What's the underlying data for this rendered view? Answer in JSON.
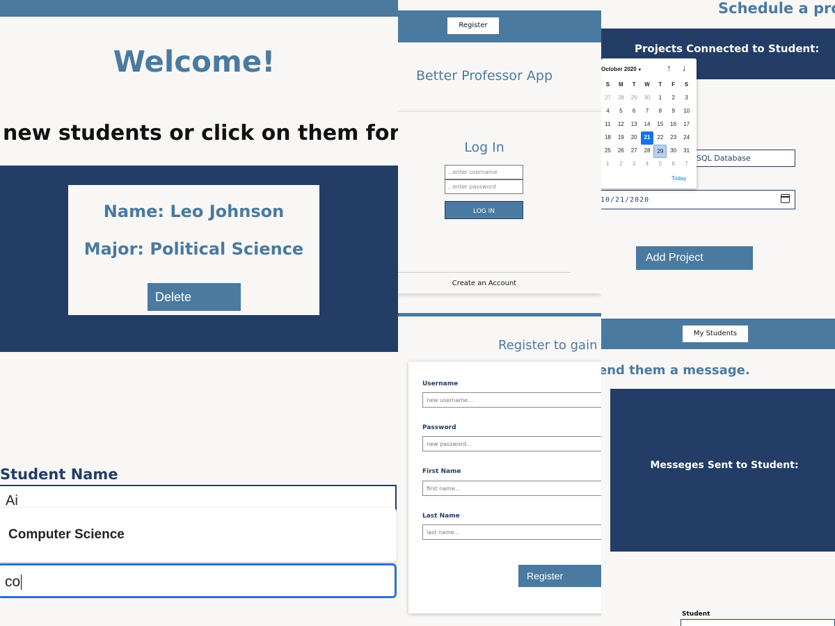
{
  "student_list_panel": {
    "welcome": "Welcome!",
    "instructions": "new students or click on them for deta",
    "student_card": {
      "name": "Name: Leo Johnson",
      "major": "Major: Political Science",
      "delete_label": "Delete"
    },
    "student_name_label": "Student Name",
    "student_name_value": "Ai",
    "suggestion": "Computer Science",
    "major_value": "co"
  },
  "login_panel": {
    "register_nav_label": "Register",
    "app_title": "Better Professor App",
    "login_title": "Log In",
    "username_placeholder": "...enter username",
    "password_placeholder": "...enter password",
    "login_button": "LOG IN",
    "create_account": "Create an Account"
  },
  "register_panel": {
    "title": "Register to gain",
    "fields": [
      {
        "label": "Username",
        "placeholder": "new username..."
      },
      {
        "label": "Password",
        "placeholder": "new password..."
      },
      {
        "label": "First Name",
        "placeholder": "first name..."
      },
      {
        "label": "Last Name",
        "placeholder": "last name..."
      }
    ],
    "register_button": "Register"
  },
  "project_panel": {
    "schedule_title": "Schedule a proje",
    "projects_heading": "Projects Connected to Student:",
    "project_name_value": "SQL Database",
    "date_value": "10/21/2020",
    "add_button": "Add Project",
    "calendar": {
      "month_label": "October 2020",
      "weekdays": [
        "S",
        "M",
        "T",
        "W",
        "T",
        "F",
        "S"
      ],
      "weeks": [
        [
          "27",
          "28",
          "29",
          "30",
          "1",
          "2",
          "3"
        ],
        [
          "4",
          "5",
          "6",
          "7",
          "8",
          "9",
          "10"
        ],
        [
          "11",
          "12",
          "13",
          "14",
          "15",
          "16",
          "17"
        ],
        [
          "18",
          "19",
          "20",
          "21",
          "22",
          "23",
          "24"
        ],
        [
          "25",
          "26",
          "27",
          "28",
          "29",
          "30",
          "31"
        ],
        [
          "1",
          "2",
          "3",
          "4",
          "5",
          "6",
          "7"
        ]
      ],
      "selected_day": "21",
      "hovered_day": "29",
      "today_label": "Today"
    }
  },
  "messages_panel": {
    "nav_button": "My Students",
    "send_message": "end them a message.",
    "messages_heading": "Messeges Sent to Student:",
    "student_label": "Student"
  },
  "colors": {
    "brand_blue": "#4a7aa0",
    "navy": "#233d66",
    "background": "#f8f7f5",
    "focus_blue": "#2c6fd2",
    "calendar_selected": "#1473e6"
  }
}
